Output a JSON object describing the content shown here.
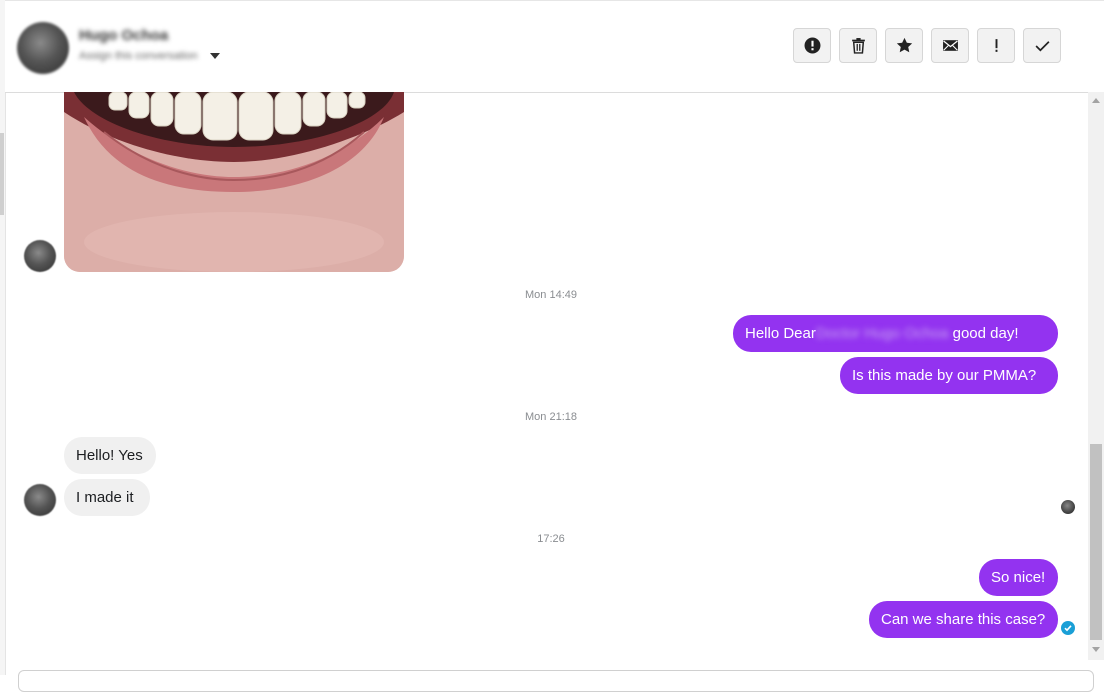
{
  "header": {
    "contact_name": "Hugo Ochoa",
    "assign_label": "Assign this conversation",
    "actions": [
      {
        "name": "report-spam-button",
        "icon": "alert-circle-icon"
      },
      {
        "name": "delete-button",
        "icon": "trash-icon"
      },
      {
        "name": "star-button",
        "icon": "star-icon"
      },
      {
        "name": "mark-unread-button",
        "icon": "envelope-icon"
      },
      {
        "name": "mark-important-button",
        "icon": "exclamation-icon"
      },
      {
        "name": "mark-done-button",
        "icon": "checkmark-icon"
      }
    ]
  },
  "messages": {
    "ts_1": "Mon 14:49",
    "out_1_prefix": "Hello Dear",
    "out_1_name": "Doctor Hugo Ochoa",
    "out_1_suffix": "good day!",
    "out_2": "Is this made by our PMMA?",
    "ts_2": "Mon 21:18",
    "in_1": "Hello! Yes",
    "in_2": "I made it",
    "ts_3": "17:26",
    "out_3": "So nice!",
    "out_4": "Can we share this case?"
  },
  "colors": {
    "outgoing_bubble": "#9333f0",
    "incoming_bubble": "#f0f0f0",
    "timestamp": "#8a8d91",
    "sent_indicator": "#1a9fd6"
  }
}
